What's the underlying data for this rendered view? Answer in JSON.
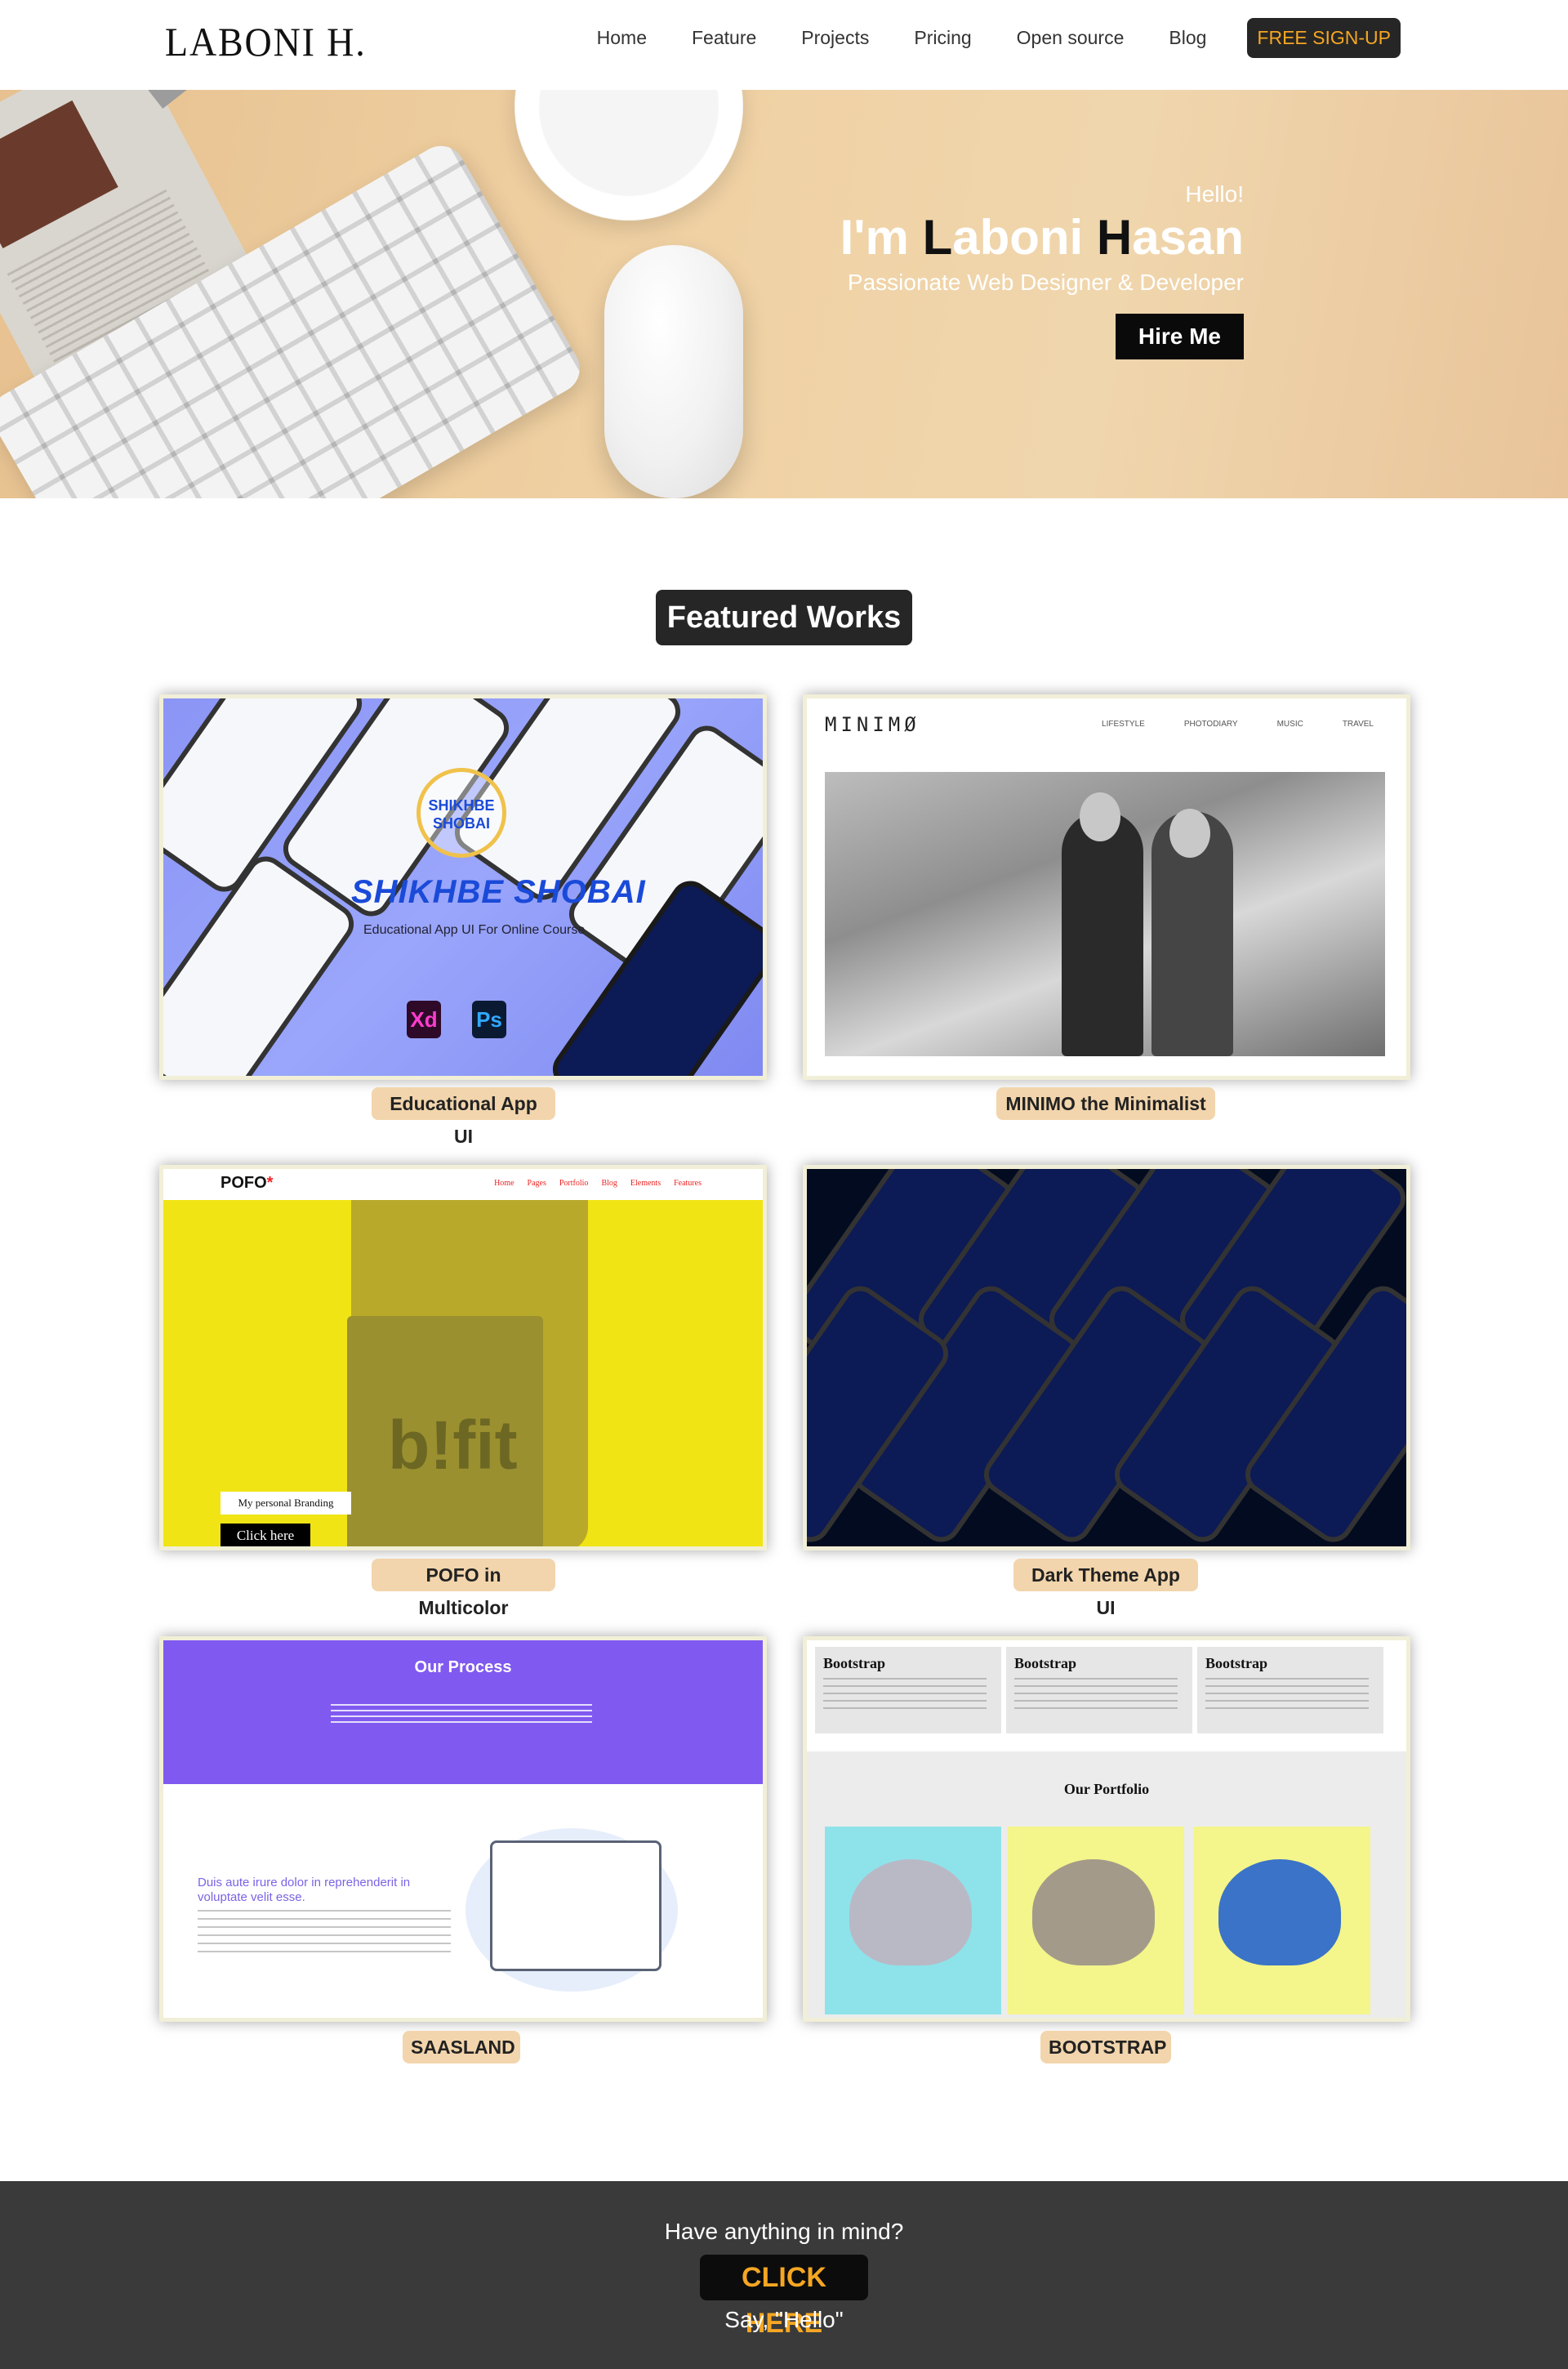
{
  "nav": {
    "logo": "LABONI H.",
    "links": [
      "Home",
      "Feature",
      "Projects",
      "Pricing",
      "Open source",
      "Blog"
    ],
    "signup": "FREE SIGN-UP"
  },
  "hero": {
    "hello": "Hello!",
    "name_prefix": "I'm ",
    "name_L": "L",
    "name_mid": "aboni ",
    "name_H": "H",
    "name_end": "asan",
    "tagline": "Passionate Web Designer & Developer",
    "hire": "Hire Me"
  },
  "featured": {
    "title": "Featured Works",
    "works": [
      {
        "caption": "Educational App UI",
        "shot": {
          "logo": "SHIKHBE SHOBAI",
          "title": "SHIKHBE SHOBAI",
          "subtitle": "Educational App UI For Online Course",
          "badge_xd": "Xd",
          "badge_ps": "Ps"
        }
      },
      {
        "caption": "MINIMO the Minimalist",
        "shot": {
          "brand": "MINIMØ",
          "menu": [
            "LIFESTYLE",
            "PHOTODIARY",
            "MUSIC",
            "TRAVEL"
          ]
        }
      },
      {
        "caption": "POFO in Multicolor",
        "shot": {
          "logo": "POFO",
          "logo_mark": "*",
          "menu": [
            "Home",
            "Pages",
            "Portfolio",
            "Blog",
            "Elements",
            "Features"
          ],
          "bag_text": "b!fit",
          "button1": "My personal Branding",
          "button2": "Click here"
        }
      },
      {
        "caption": "Dark Theme App UI",
        "shot": {}
      },
      {
        "caption": "SAASLAND",
        "shot": {
          "title": "Our Process",
          "heading": "Duis aute irure dolor in reprehenderit in voluptate velit esse."
        }
      },
      {
        "caption": "BOOTSTRAP",
        "shot": {
          "box_title": "Bootstrap",
          "portfolio_title": "Our Portfolio"
        }
      }
    ]
  },
  "footer": {
    "ask": "Have anything in mind?",
    "click": "CLICK HERE",
    "say": "Say, \"Hello\""
  }
}
